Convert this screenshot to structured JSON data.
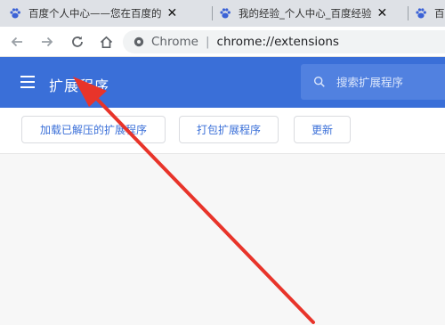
{
  "tabs": [
    {
      "title": "百度个人中心——您在百度的"
    },
    {
      "title": "我的经验_个人中心_百度经验"
    },
    {
      "title": "百"
    }
  ],
  "tab_close_glyph": "✕",
  "omnibox": {
    "security_label": "Chrome",
    "url": "chrome://extensions"
  },
  "header": {
    "title": "扩展程序",
    "search_placeholder": "搜索扩展程序"
  },
  "actions": {
    "load_unpacked": "加载已解压的扩展程序",
    "pack": "打包扩展程序",
    "update": "更新"
  },
  "colors": {
    "accent": "#3a6fd8",
    "annotation_arrow": "#e8342a"
  },
  "icons": [
    "baidu-paw-icon",
    "back-icon",
    "forward-icon",
    "reload-icon",
    "home-icon",
    "site-info-icon",
    "menu-icon",
    "search-icon"
  ]
}
